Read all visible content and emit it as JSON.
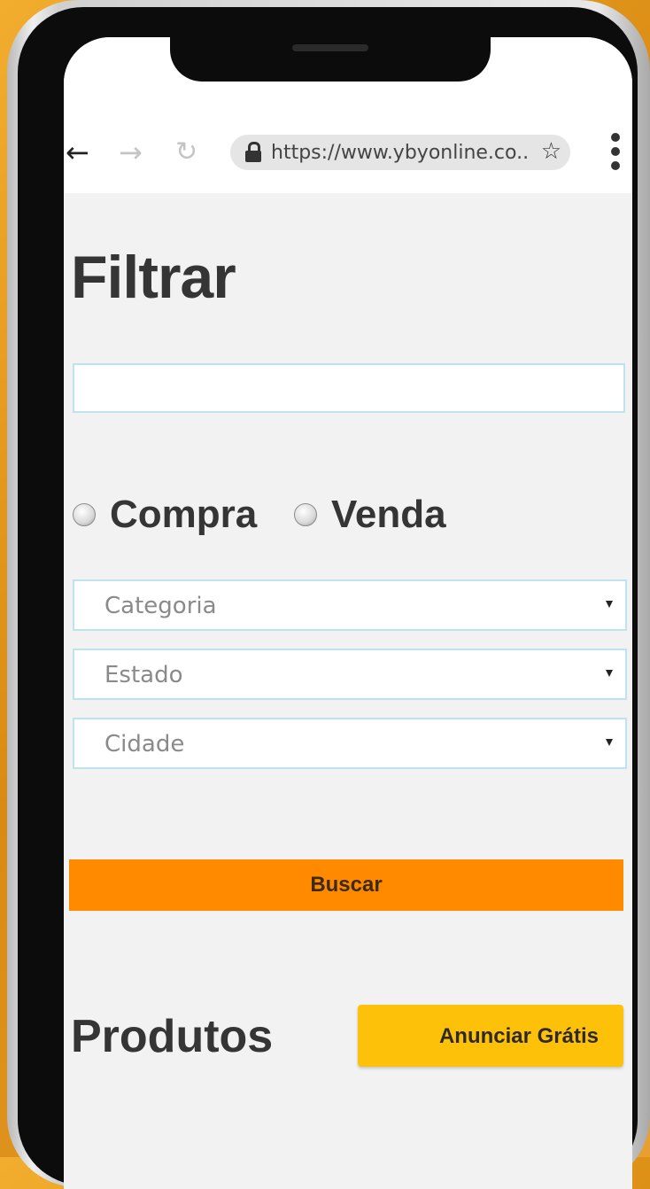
{
  "browser": {
    "url": "https://www.ybyonline.co..",
    "back_icon": "arrow-left-icon",
    "forward_icon": "arrow-right-icon",
    "reload_icon": "reload-icon",
    "lock_icon": "lock-icon",
    "bookmark_icon": "star-icon",
    "menu_icon": "more-vertical-icon"
  },
  "filter": {
    "title": "Filtrar",
    "search_value": "",
    "radio_options": [
      "Compra",
      "Venda"
    ],
    "selects": [
      {
        "placeholder": "Categoria"
      },
      {
        "placeholder": "Estado"
      },
      {
        "placeholder": "Cidade"
      }
    ],
    "search_button": "Buscar"
  },
  "products": {
    "title": "Produtos",
    "announce_button": "Anunciar Grátis"
  },
  "colors": {
    "accent_orange": "#ff8a00",
    "accent_yellow": "#fec10a",
    "input_border": "#bfe3ee",
    "page_background": "#f2f2f2",
    "heading_text": "#353535"
  }
}
